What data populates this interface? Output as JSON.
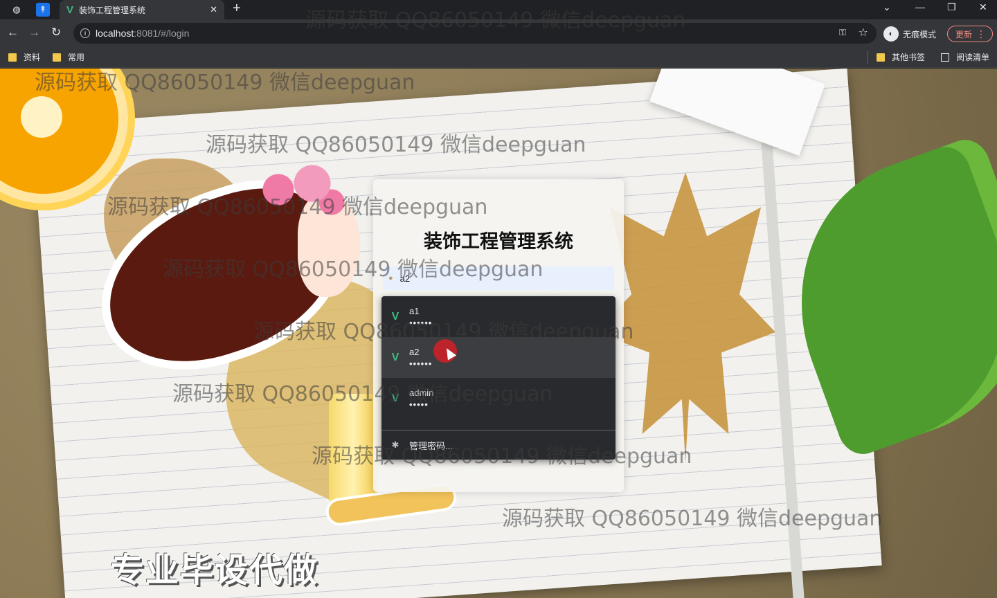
{
  "browser": {
    "tab_title": "装饰工程管理系统",
    "url_host": "localhost",
    "url_path": ":8081/#/login",
    "incognito_label": "无痕模式",
    "update_label": "更新",
    "bookmarks": [
      "资料",
      "常用"
    ],
    "other_bookmarks": "其他书签",
    "reading_list": "阅读清单"
  },
  "page": {
    "title": "装饰工程管理系统",
    "username_value": "a2",
    "slogan": "专业毕设代做"
  },
  "autofill": {
    "items": [
      {
        "username": "a1",
        "password": "••••••"
      },
      {
        "username": "a2",
        "password": "••••••"
      },
      {
        "username": "admin",
        "password": "•••••"
      }
    ],
    "manage_label": "管理密码..."
  },
  "watermark": "源码获取 QQ86050149 微信deepguan",
  "colors": {
    "vue_green": "#41b883",
    "chrome_dark": "#202124",
    "chrome_toolbar": "#35363a",
    "autofill_bg": "#292a2d",
    "update_red": "#f28b82"
  }
}
